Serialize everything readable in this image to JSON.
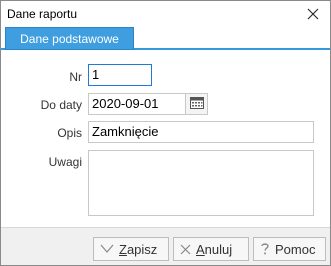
{
  "window": {
    "title": "Dane raportu"
  },
  "tabs": [
    {
      "label": "Dane podstawowe",
      "active": true
    }
  ],
  "form": {
    "nr": {
      "label": "Nr",
      "value": "1"
    },
    "do_daty": {
      "label": "Do daty",
      "value": "2020-09-01"
    },
    "opis": {
      "label": "Opis",
      "value": "Zamknięcie"
    },
    "uwagi": {
      "label": "Uwagi",
      "value": ""
    }
  },
  "buttons": {
    "zapisz": {
      "mnemonic": "Z",
      "rest": "apisz"
    },
    "anuluj": {
      "mnemonic": "A",
      "rest": "nuluj"
    },
    "pomoc": {
      "label": "Pomoc"
    }
  },
  "icons": {
    "close": "close-icon",
    "calendar": "calendar-icon",
    "save": "checkmark-icon",
    "cancel": "cross-icon",
    "help": "question-icon"
  },
  "colors": {
    "accent": "#3f9ee0",
    "focus_border": "#1e7ad6"
  }
}
